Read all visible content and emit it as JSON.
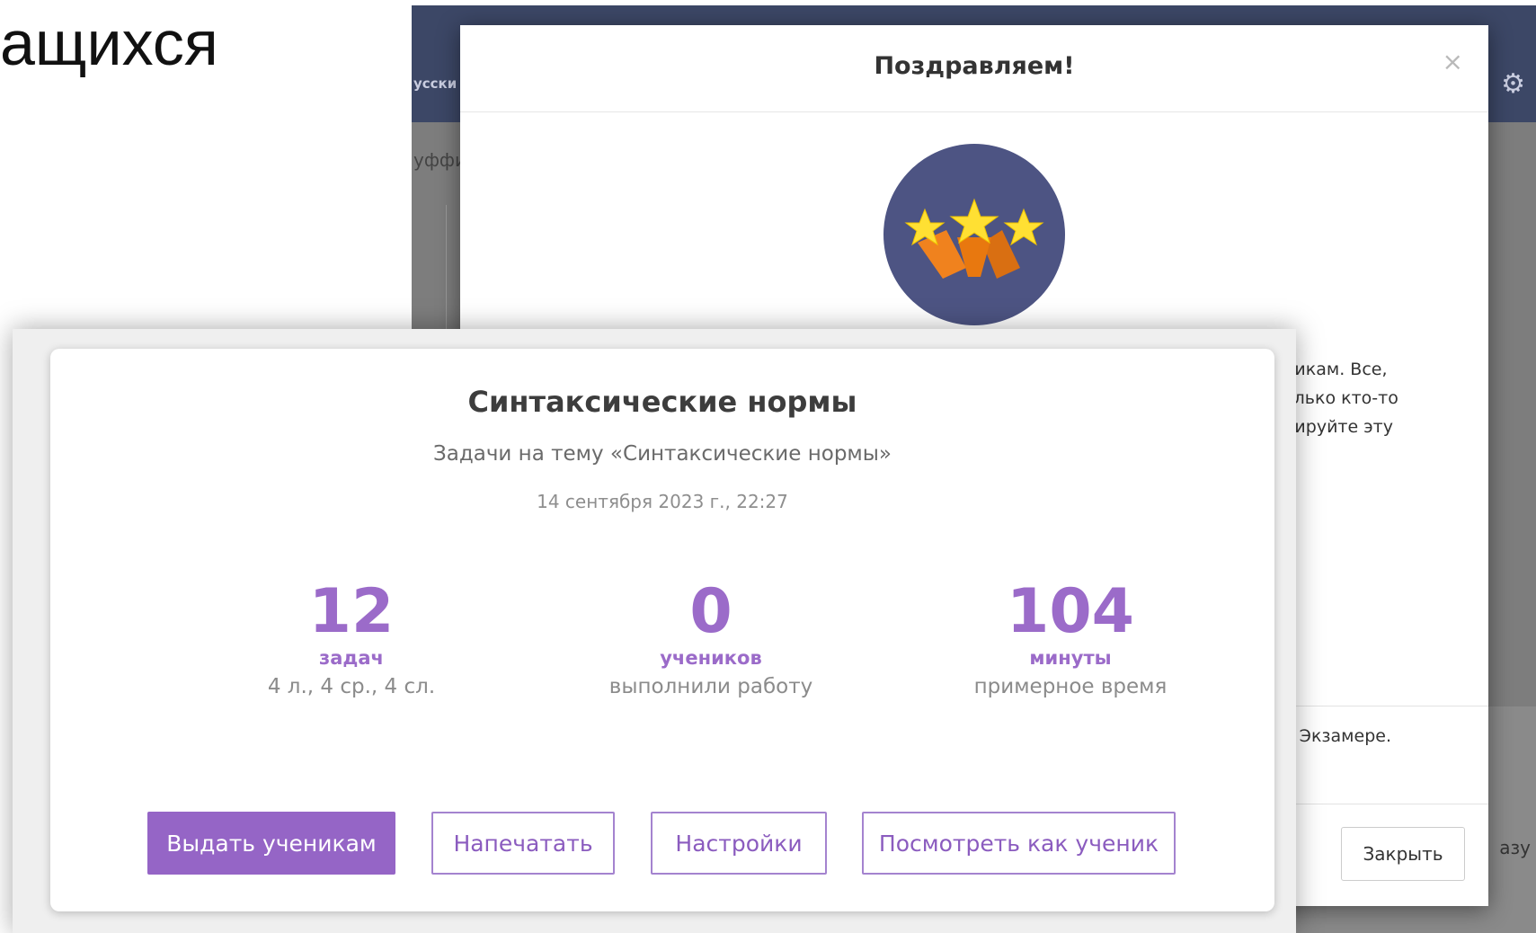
{
  "slide": {
    "heading": "ащихся"
  },
  "background_app": {
    "tab_label": "усски",
    "content_label": "уффи",
    "side_text": "азу",
    "icons": [
      "gear-icon"
    ]
  },
  "modal": {
    "title": "Поздравляем!",
    "close_symbol": "×",
    "text_lines": [
      "никам. Все,",
      "олько кто-то",
      "пируйте эту"
    ],
    "exam_line": "а Экзамере.",
    "close_button_label": "Закрыть",
    "medal": {
      "icon": "three-stars-icon",
      "bg_color": "#4d5483",
      "star_color": "#ffe033",
      "trail_color": "#f0821e"
    }
  },
  "work": {
    "title": "Синтаксические нормы",
    "subtitle": "Задачи на тему «Синтаксические нормы»",
    "datetime": "14 сентября 2023 г., 22:27",
    "stats": [
      {
        "value": "12",
        "unit": "задач",
        "note": "4 л., 4 ср., 4 сл."
      },
      {
        "value": "0",
        "unit": "учеников",
        "note": "выполнили работу"
      },
      {
        "value": "104",
        "unit": "минуты",
        "note": "примерное время"
      }
    ],
    "buttons": {
      "assign": "Выдать ученикам",
      "print": "Напечатать",
      "settings": "Настройки",
      "preview": "Посмотреть как ученик"
    },
    "accent_color": "#9b6bc9"
  }
}
